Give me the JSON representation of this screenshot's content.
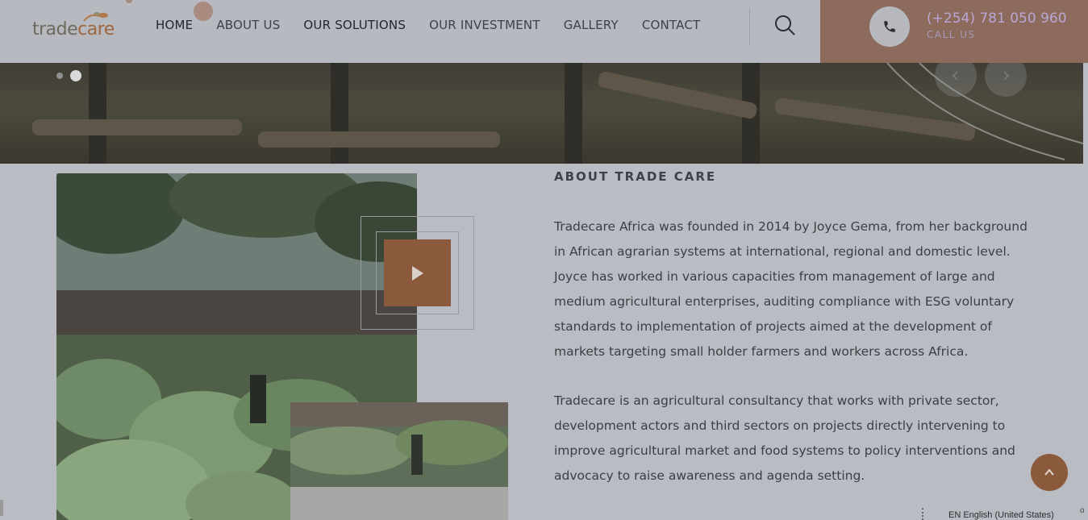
{
  "header": {
    "logo": {
      "part1": "trade",
      "part2": "care"
    },
    "nav": [
      {
        "label": "HOME",
        "key": "home"
      },
      {
        "label": "ABOUT US",
        "key": "about"
      },
      {
        "label": "OUR SOLUTIONS",
        "key": "solutions"
      },
      {
        "label": "OUR INVESTMENT",
        "key": "investment"
      },
      {
        "label": "GALLERY",
        "key": "gallery"
      },
      {
        "label": "CONTACT",
        "key": "contact"
      }
    ],
    "search_icon": "search-icon",
    "call": {
      "number": "(+254) 781 050 960",
      "label": "CALL US",
      "icon": "phone-icon"
    }
  },
  "hero": {
    "slide_dots": 2,
    "active_dot": 2,
    "prev_icon": "chevron-left-icon",
    "next_icon": "chevron-right-icon"
  },
  "about": {
    "title": "ABOUT TRADE CARE",
    "paragraphs": [
      "Tradecare Africa was founded in 2014 by Joyce Gema, from her background in African agrarian systems at international, regional and domestic level. Joyce has worked in various capacities from management of large and medium agricultural enterprises, auditing compliance with ESG voluntary standards to implementation of projects aimed at the development of markets targeting small holder farmers and workers across Africa.",
      "Tradecare is an agricultural consultancy that works with private sector, development actors and third sectors on projects directly intervening to improve agricultural market and food systems to policy interventions and advocacy to raise awareness and agenda setting."
    ],
    "play_icon": "play-icon"
  },
  "footer": {
    "language": "EN English (United States)",
    "scroll_top_icon": "chevron-up-icon",
    "edge_char": "o"
  },
  "colors": {
    "accent": "#8b5a3c",
    "call_bg": "#8c6b5c",
    "header_bg": "#b6b9c0",
    "overlay_bg": "#b9bcc2"
  }
}
